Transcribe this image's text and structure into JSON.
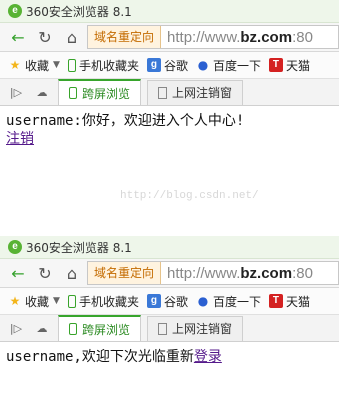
{
  "window": {
    "title": "360安全浏览器 8.1",
    "icon_letter": "e"
  },
  "navbar": {
    "redirect_label": "域名重定向",
    "url_prefix": "http://www.",
    "url_domain": "bz.com",
    "url_suffix": ":80",
    "icons": [
      "back-arrow-icon",
      "refresh-icon",
      "home-icon"
    ]
  },
  "bookmarks": {
    "favorites": "收藏",
    "mobile_favorites": "手机收藏夹",
    "google": "谷歌",
    "baidu": "百度一下",
    "tmall": "天猫"
  },
  "tabs": [
    {
      "label": "跨屏浏览"
    },
    {
      "label": "上网注销窗"
    }
  ],
  "page1": {
    "message": "username:你好，欢迎进入个人中心!",
    "logout_link": "注销"
  },
  "page2": {
    "message": "username,欢迎下次光临重新",
    "login_link": "登录"
  },
  "watermark": "http://blog.csdn.net/"
}
